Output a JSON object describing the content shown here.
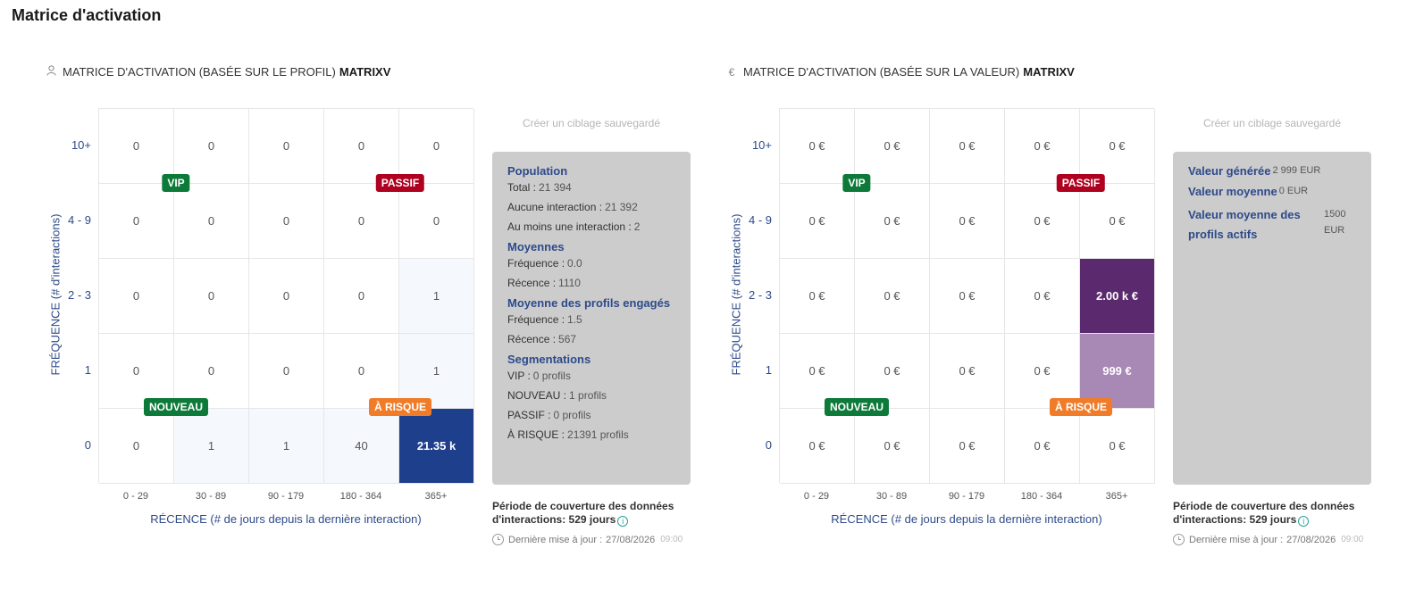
{
  "page_title": "Matrice d'activation",
  "colors": {
    "vip": "#0e7a3a",
    "passif": "#b00020",
    "nouveau": "#0e7a3a",
    "a_risque": "#f07c2a",
    "accent": "#2d4a8a"
  },
  "matrices": [
    {
      "icon": "user-icon",
      "title_prefix": "MATRICE D'ACTIVATION (BASÉE SUR LE PROFIL)",
      "title_bold": "MATRIXV",
      "y_axis": "FRÉQUENCE (# d'interactions)",
      "x_axis": "RÉCENCE (# de jours depuis la dernière interaction)",
      "rows": [
        "10+",
        "4 - 9",
        "2 - 3",
        "1",
        "0"
      ],
      "cols": [
        "0 - 29",
        "30 - 89",
        "90 - 179",
        "180 - 364",
        "365+"
      ],
      "cells": [
        [
          "0",
          "0",
          "0",
          "0",
          "0"
        ],
        [
          "0",
          "0",
          "0",
          "0",
          "0"
        ],
        [
          "0",
          "0",
          "0",
          "0",
          "1"
        ],
        [
          "0",
          "0",
          "0",
          "0",
          "1"
        ],
        [
          "0",
          "1",
          "1",
          "40",
          "21.35 k"
        ]
      ],
      "badges": {
        "vip": "VIP",
        "passif": "PASSIF",
        "nouveau": "NOUVEAU",
        "a_risque": "À RISQUE"
      },
      "save_target": "Créer un ciblage sauvegardé",
      "info": {
        "population": {
          "title": "Population",
          "total_label": "Total :",
          "total": "21 394",
          "none_label": "Aucune interaction :",
          "none": "21 392",
          "some_label": "Au moins une interaction :",
          "some": "2"
        },
        "moyennes": {
          "title": "Moyennes",
          "freq_label": "Fréquence :",
          "freq": "0.0",
          "rec_label": "Récence :",
          "rec": "1110"
        },
        "engages": {
          "title": "Moyenne des profils engagés",
          "freq_label": "Fréquence :",
          "freq": "1.5",
          "rec_label": "Récence :",
          "rec": "567"
        },
        "segmentations": {
          "title": "Segmentations",
          "vip_label": "VIP :",
          "vip": "0 profils",
          "nouveau_label": "NOUVEAU :",
          "nouveau": "1 profils",
          "passif_label": "PASSIF :",
          "passif": "0 profils",
          "risque_label": "À RISQUE :",
          "risque": "21391 profils"
        }
      },
      "coverage_prefix": "Période de couverture des données d'interactions:",
      "coverage_value": "529 jours",
      "updated_label": "Dernière mise à jour :",
      "updated_date": "27/08/2026",
      "updated_time": "09:00"
    },
    {
      "icon": "euro-icon",
      "title_prefix": "MATRICE D'ACTIVATION (BASÉE SUR LA VALEUR)",
      "title_bold": "MATRIXV",
      "y_axis": "FRÉQUENCE (# d'interactions)",
      "x_axis": "RÉCENCE (# de jours depuis la dernière interaction)",
      "rows": [
        "10+",
        "4 - 9",
        "2 - 3",
        "1",
        "0"
      ],
      "cols": [
        "0 - 29",
        "30 - 89",
        "90 - 179",
        "180 - 364",
        "365+"
      ],
      "cells": [
        [
          "0 €",
          "0 €",
          "0 €",
          "0 €",
          "0 €"
        ],
        [
          "0 €",
          "0 €",
          "0 €",
          "0 €",
          "0 €"
        ],
        [
          "0 €",
          "0 €",
          "0 €",
          "0 €",
          "2.00 k €"
        ],
        [
          "0 €",
          "0 €",
          "0 €",
          "0 €",
          "999 €"
        ],
        [
          "0 €",
          "0 €",
          "0 €",
          "0 €",
          "0 €"
        ]
      ],
      "badges": {
        "vip": "VIP",
        "passif": "PASSIF",
        "nouveau": "NOUVEAU",
        "a_risque": "À RISQUE"
      },
      "save_target": "Créer un ciblage sauvegardé",
      "values": {
        "generated_label": "Valeur générée",
        "generated": "2 999 EUR",
        "mean_label": "Valeur moyenne",
        "mean": "0 EUR",
        "mean_active_label": "Valeur moyenne des profils actifs",
        "mean_active": "1500 EUR"
      },
      "coverage_prefix": "Période de couverture des données d'interactions:",
      "coverage_value": "529 jours",
      "updated_label": "Dernière mise à jour :",
      "updated_date": "27/08/2026",
      "updated_time": "09:00"
    }
  ]
}
